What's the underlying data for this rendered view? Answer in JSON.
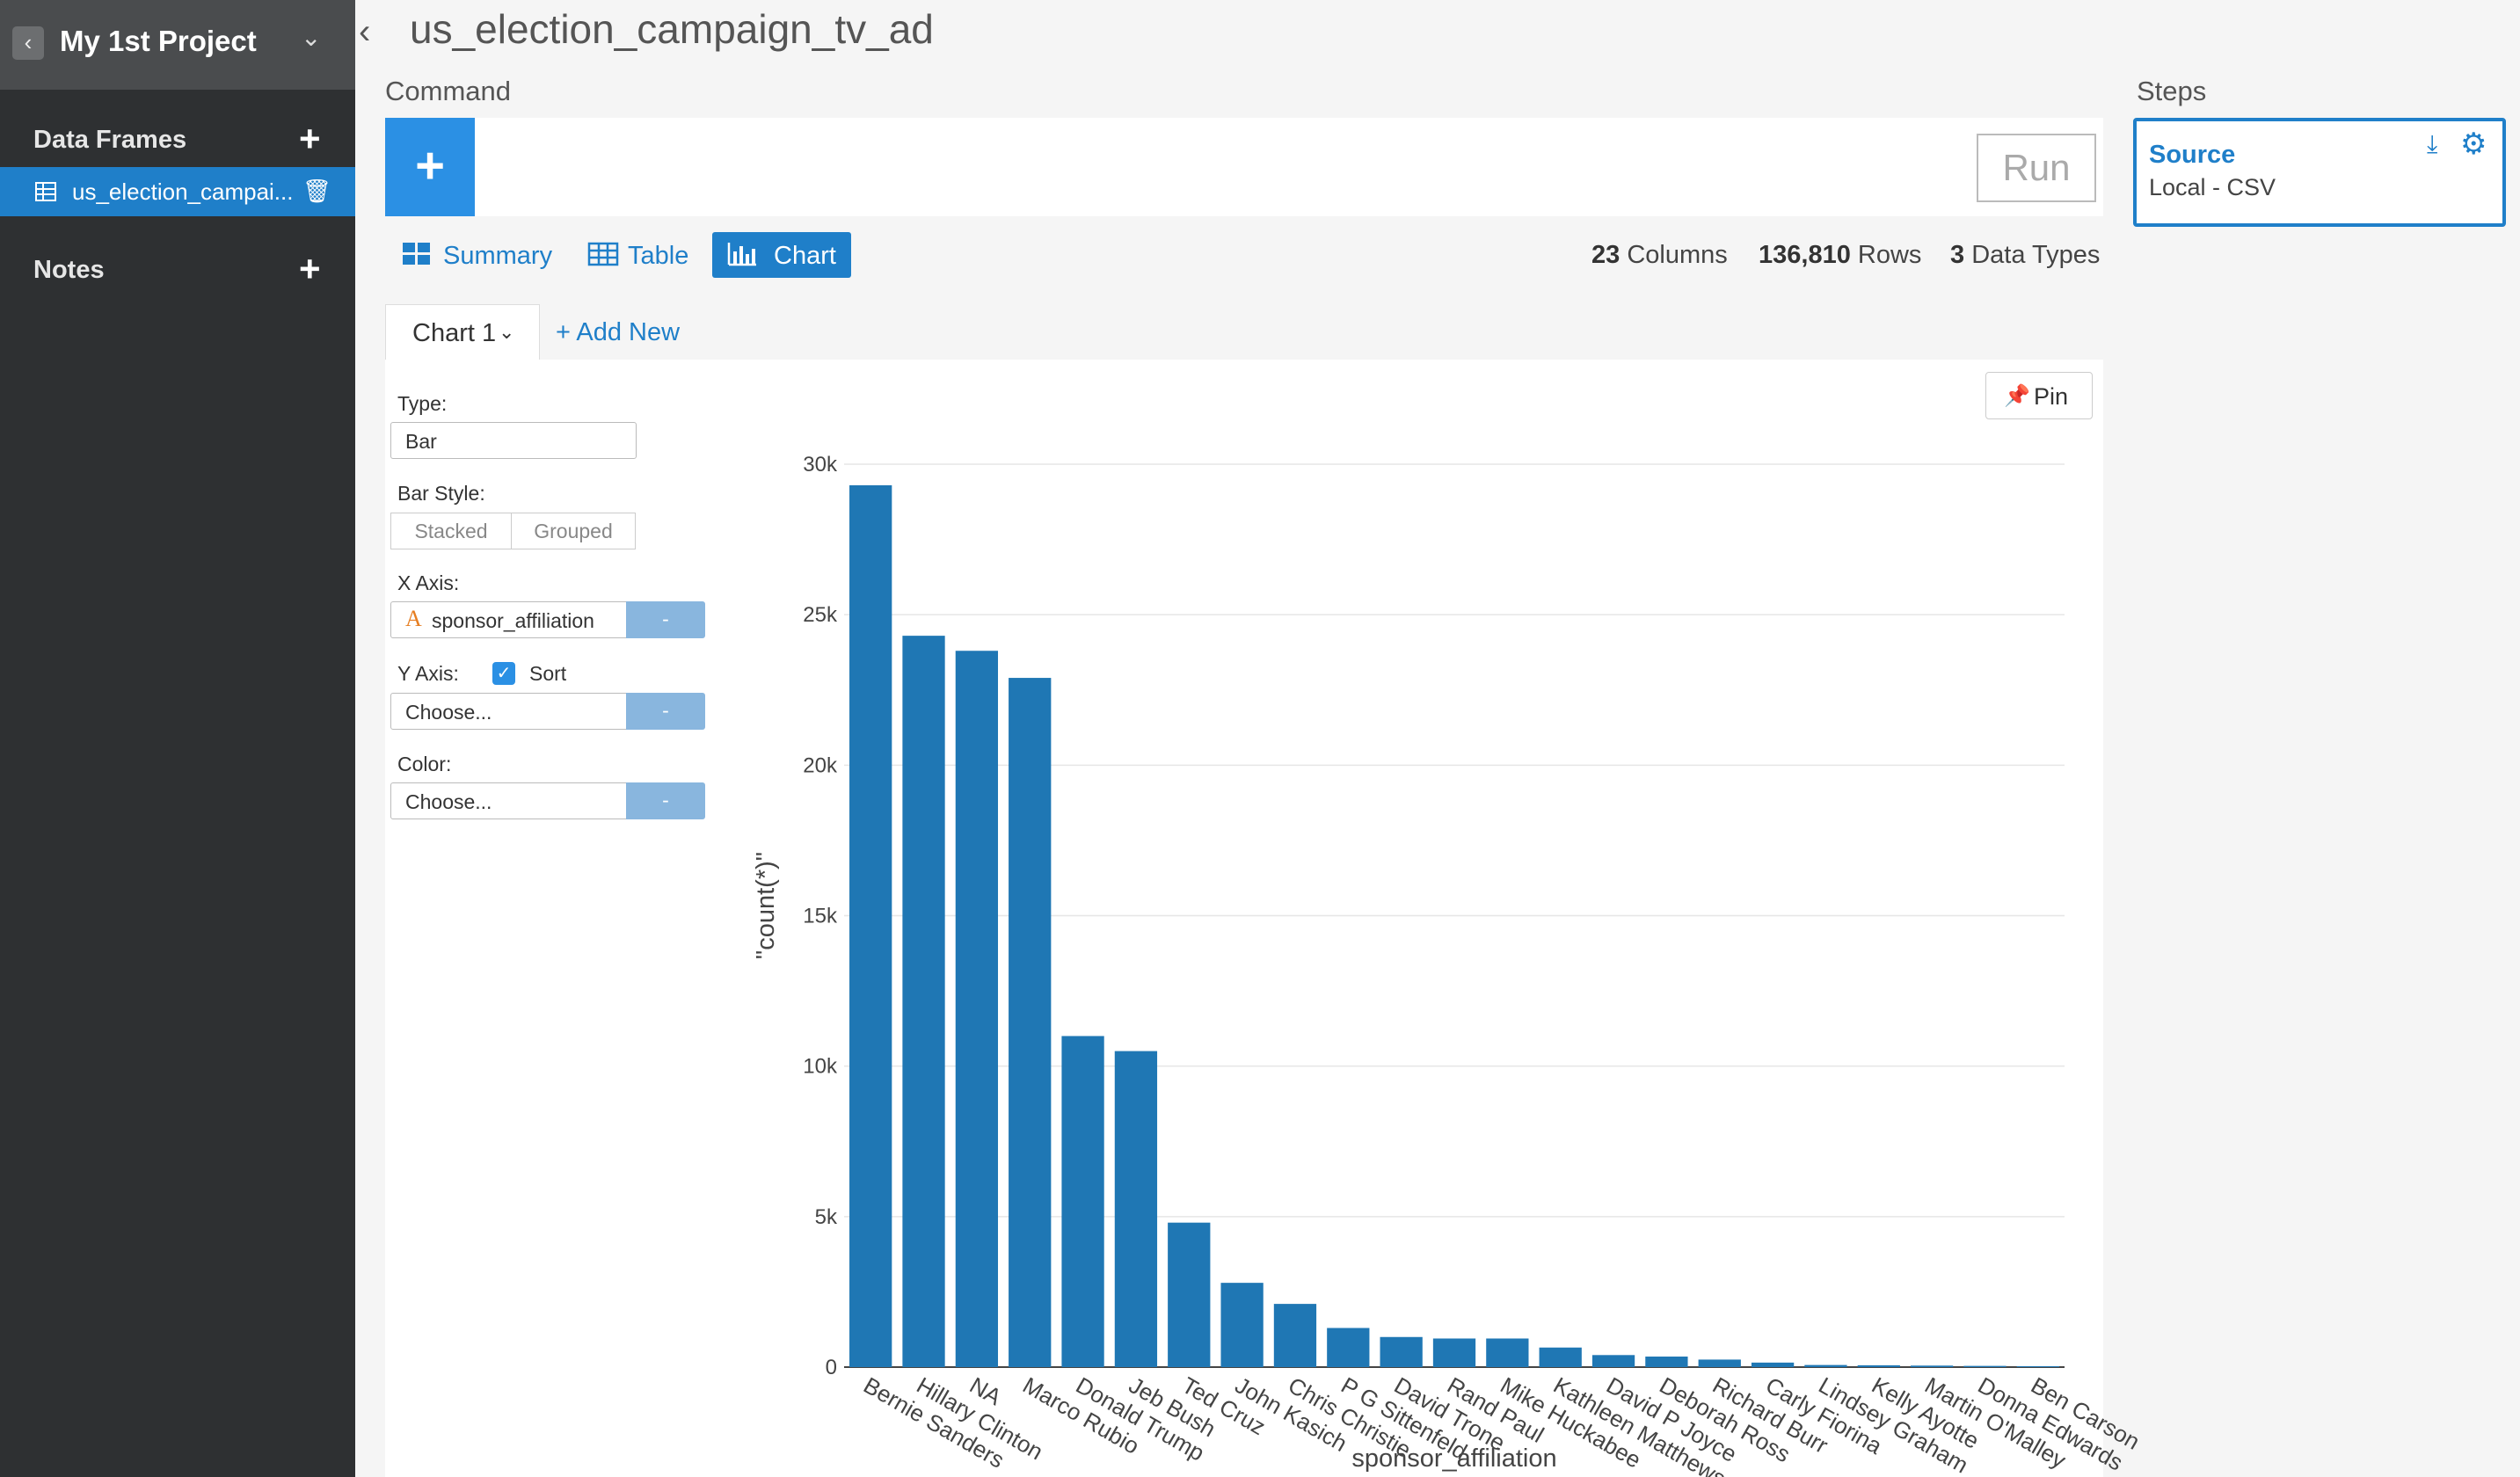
{
  "sidebar": {
    "project_title": "My 1st Project",
    "data_frames_label": "Data Frames",
    "data_frame_item": "us_election_campai...",
    "notes_label": "Notes"
  },
  "header": {
    "frame_title": "us_election_campaign_tv_ad",
    "command_label": "Command",
    "steps_label": "Steps",
    "run_label": "Run"
  },
  "steps": [
    {
      "title": "Source",
      "subtitle": "Local - CSV"
    }
  ],
  "view_tabs": [
    {
      "label": "Summary",
      "icon": "summary-icon",
      "active": false
    },
    {
      "label": "Table",
      "icon": "table-icon",
      "active": false
    },
    {
      "label": "Chart",
      "icon": "bar-chart-icon",
      "active": true
    }
  ],
  "stats": {
    "columns_count": "23",
    "columns_label": "Columns",
    "rows_count": "136,810",
    "rows_label": "Rows",
    "types_count": "3",
    "types_label": "Data Types"
  },
  "chart_tabs": {
    "current": "Chart 1",
    "add_new": "+ Add New"
  },
  "config": {
    "type_label": "Type:",
    "type_value": "Bar",
    "bar_style_label": "Bar Style:",
    "bar_style_options": [
      "Stacked",
      "Grouped"
    ],
    "x_axis_label": "X Axis:",
    "x_axis_value": "sponsor_affiliation",
    "x_axis_type_glyph": "A",
    "y_axis_label": "Y Axis:",
    "sort_label": "Sort",
    "sort_checked": true,
    "y_axis_value": "Choose...",
    "color_label": "Color:",
    "color_value": "Choose...",
    "dash_label": "-"
  },
  "pin_label": "Pin",
  "colors": {
    "accent": "#1f7fc9",
    "bar": "#1f77b4",
    "sidebar_bg": "#2e3032"
  },
  "chart_data": {
    "type": "bar",
    "xlabel": "sponsor_affiliation",
    "ylabel": "\"count(*)\"",
    "ylim": [
      0,
      30000
    ],
    "yticks": [
      0,
      5000,
      10000,
      15000,
      20000,
      25000,
      30000
    ],
    "ytick_labels": [
      "0",
      "5k",
      "10k",
      "15k",
      "20k",
      "25k",
      "30k"
    ],
    "categories": [
      "Bernie Sanders",
      "Hillary Clinton",
      "NA",
      "Marco Rubio",
      "Donald Trump",
      "Jeb Bush",
      "Ted Cruz",
      "John Kasich",
      "Chris Christie",
      "P G Sittenfeld",
      "David Trone",
      "Rand Paul",
      "Mike Huckabee",
      "Kathleen Matthews",
      "David P Joyce",
      "Deborah Ross",
      "Richard Burr",
      "Carly Fiorina",
      "Lindsey Graham",
      "Kelly Ayotte",
      "Martin O'Malley",
      "Donna Edwards",
      "Ben Carson"
    ],
    "values": [
      29300,
      24300,
      23800,
      22900,
      11000,
      10500,
      4800,
      2800,
      2100,
      1300,
      1000,
      950,
      950,
      650,
      400,
      350,
      250,
      150,
      70,
      60,
      50,
      40,
      30
    ],
    "grid": true
  }
}
